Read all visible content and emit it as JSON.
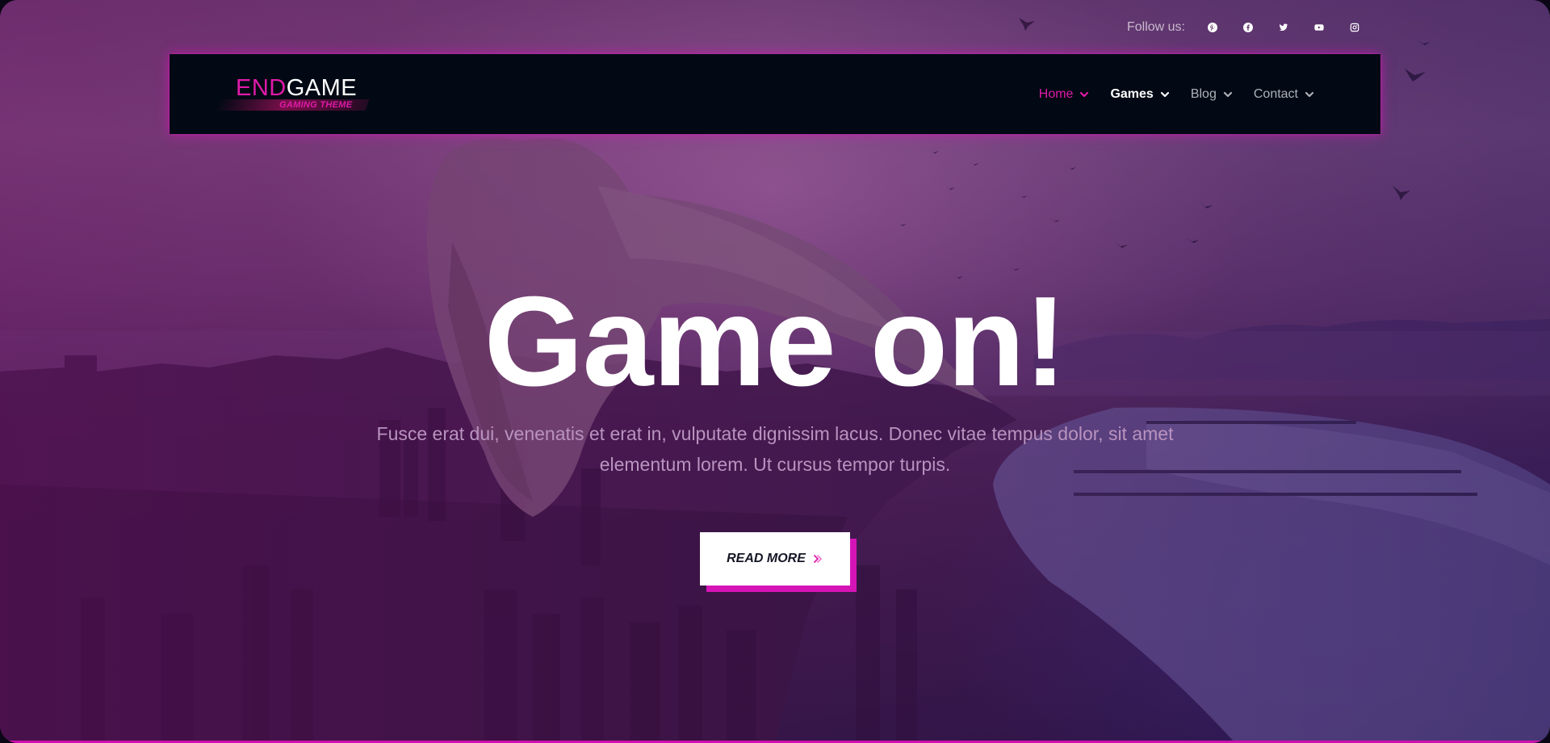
{
  "social": {
    "label": "Follow us:",
    "icons": [
      "pinterest-icon",
      "facebook-icon",
      "twitter-icon",
      "youtube-icon",
      "instagram-icon"
    ]
  },
  "logo": {
    "part1": "END",
    "part2": "GAME",
    "subtitle": "GAMING THEME"
  },
  "nav": {
    "items": [
      {
        "label": "Home",
        "active": true
      },
      {
        "label": "Games",
        "active": false
      },
      {
        "label": "Blog",
        "active": false
      },
      {
        "label": "Contact",
        "active": false
      }
    ]
  },
  "hero": {
    "title": "Game on!",
    "text": "Fusce erat dui, venenatis et erat in, vulputate dignissim lacus. Donec vitae tempus dolor, sit amet elementum lorem. Ut cursus tempor turpis.",
    "cta_label": "READ MORE"
  },
  "colors": {
    "accent": "#e01aa8",
    "header_bg": "#020914",
    "nav_active": "#e01aa8",
    "nav_highlight": "#ffffff",
    "nav_default": "#aeb1b8"
  }
}
